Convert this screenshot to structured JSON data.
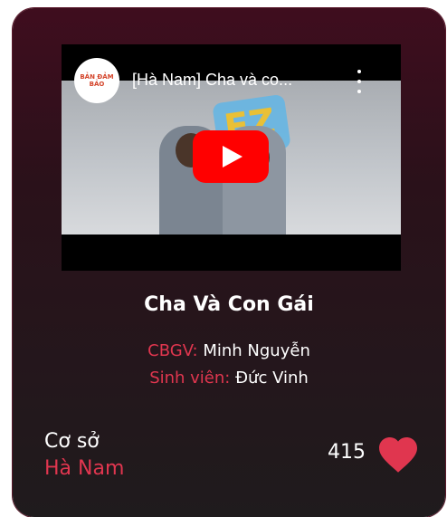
{
  "video": {
    "channel_logo_text": "BẢN ĐẢM BẢO",
    "title": "[Hà Nam] Cha và co..."
  },
  "card": {
    "title": "Cha Và Con Gái",
    "teacher_label": "CBGV:",
    "teacher_name": "Minh Nguyễn",
    "student_label": "Sinh viên:",
    "student_name": "Đức Vinh",
    "campus_label": "Cơ sở",
    "campus_value": "Hà Nam",
    "likes": "415"
  },
  "colors": {
    "accent": "#e0364f",
    "heart": "#e0364f",
    "play": "#ff0000"
  },
  "icons": [
    "kebab-menu-icon",
    "play-icon",
    "heart-icon",
    "channel-logo"
  ]
}
